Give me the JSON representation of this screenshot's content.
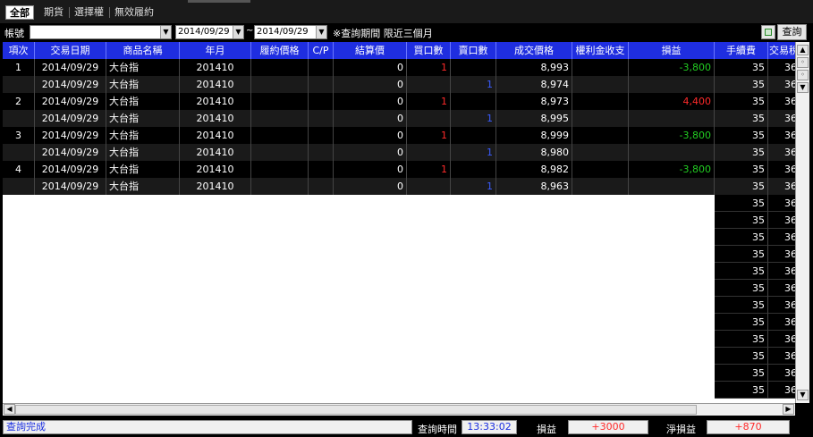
{
  "tabs": [
    {
      "label": "全部",
      "active": true
    },
    {
      "label": "期貨",
      "active": false
    },
    {
      "label": "選擇權",
      "active": false
    },
    {
      "label": "無效履約",
      "active": false
    }
  ],
  "toolbar": {
    "account_label": "帳號",
    "account_value": "",
    "date_from": "2014/09/29",
    "date_to": "2014/09/29",
    "tilde": "~",
    "note": "※查詢期間 限近三個月",
    "query_button": "查詢"
  },
  "columns": [
    "項次",
    "交易日期",
    "商品名稱",
    "年月",
    "履約價格",
    "C/P",
    "結算價",
    "買口數",
    "賣口數",
    "成交價格",
    "權利金收支",
    "損益",
    "手續費",
    "交易稅"
  ],
  "rows": [
    {
      "idx": "1",
      "date": "2014/09/29",
      "product": "大台指",
      "ym": "201410",
      "strike": "",
      "cp": "",
      "settle": "0",
      "buy": "1",
      "sell": "",
      "price": "8,993",
      "premium": "",
      "pnl": "-3,800",
      "fee": "35",
      "tax": "36"
    },
    {
      "idx": "",
      "date": "2014/09/29",
      "product": "大台指",
      "ym": "201410",
      "strike": "",
      "cp": "",
      "settle": "0",
      "buy": "",
      "sell": "1",
      "price": "8,974",
      "premium": "",
      "pnl": "",
      "fee": "35",
      "tax": "36"
    },
    {
      "idx": "2",
      "date": "2014/09/29",
      "product": "大台指",
      "ym": "201410",
      "strike": "",
      "cp": "",
      "settle": "0",
      "buy": "1",
      "sell": "",
      "price": "8,973",
      "premium": "",
      "pnl": "4,400",
      "fee": "35",
      "tax": "36"
    },
    {
      "idx": "",
      "date": "2014/09/29",
      "product": "大台指",
      "ym": "201410",
      "strike": "",
      "cp": "",
      "settle": "0",
      "buy": "",
      "sell": "1",
      "price": "8,995",
      "premium": "",
      "pnl": "",
      "fee": "35",
      "tax": "36"
    },
    {
      "idx": "3",
      "date": "2014/09/29",
      "product": "大台指",
      "ym": "201410",
      "strike": "",
      "cp": "",
      "settle": "0",
      "buy": "1",
      "sell": "",
      "price": "8,999",
      "premium": "",
      "pnl": "-3,800",
      "fee": "35",
      "tax": "36"
    },
    {
      "idx": "",
      "date": "2014/09/29",
      "product": "大台指",
      "ym": "201410",
      "strike": "",
      "cp": "",
      "settle": "0",
      "buy": "",
      "sell": "1",
      "price": "8,980",
      "premium": "",
      "pnl": "",
      "fee": "35",
      "tax": "36"
    },
    {
      "idx": "4",
      "date": "2014/09/29",
      "product": "大台指",
      "ym": "201410",
      "strike": "",
      "cp": "",
      "settle": "0",
      "buy": "1",
      "sell": "",
      "price": "8,982",
      "premium": "",
      "pnl": "-3,800",
      "fee": "35",
      "tax": "36"
    },
    {
      "idx": "",
      "date": "2014/09/29",
      "product": "大台指",
      "ym": "201410",
      "strike": "",
      "cp": "",
      "settle": "0",
      "buy": "",
      "sell": "1",
      "price": "8,963",
      "premium": "",
      "pnl": "",
      "fee": "35",
      "tax": "36"
    }
  ],
  "extra_rows": [
    {
      "fee": "35",
      "tax": "36"
    },
    {
      "fee": "35",
      "tax": "36"
    },
    {
      "fee": "35",
      "tax": "36"
    },
    {
      "fee": "35",
      "tax": "36"
    },
    {
      "fee": "35",
      "tax": "36"
    },
    {
      "fee": "35",
      "tax": "36"
    },
    {
      "fee": "35",
      "tax": "36"
    },
    {
      "fee": "35",
      "tax": "36"
    },
    {
      "fee": "35",
      "tax": "36"
    },
    {
      "fee": "35",
      "tax": "36"
    },
    {
      "fee": "35",
      "tax": "36"
    },
    {
      "fee": "35",
      "tax": "36"
    }
  ],
  "status": {
    "message": "查詢完成",
    "time_label": "查詢時間",
    "time_value": "13:33:02",
    "pnl_label": "損益",
    "pnl_value": "+3000",
    "net_label": "淨損益",
    "net_value": "+870"
  },
  "colors": {
    "header_bg": "#1f2ee0",
    "row_odd": "#000000",
    "row_even": "#1a1a1a",
    "loss": "#22cc22",
    "profit": "#ff2a2a",
    "buy": "#ff2a2a",
    "sell": "#3a5cff",
    "status_text": "#1a2ee0",
    "status_red": "#ff2a2a"
  }
}
